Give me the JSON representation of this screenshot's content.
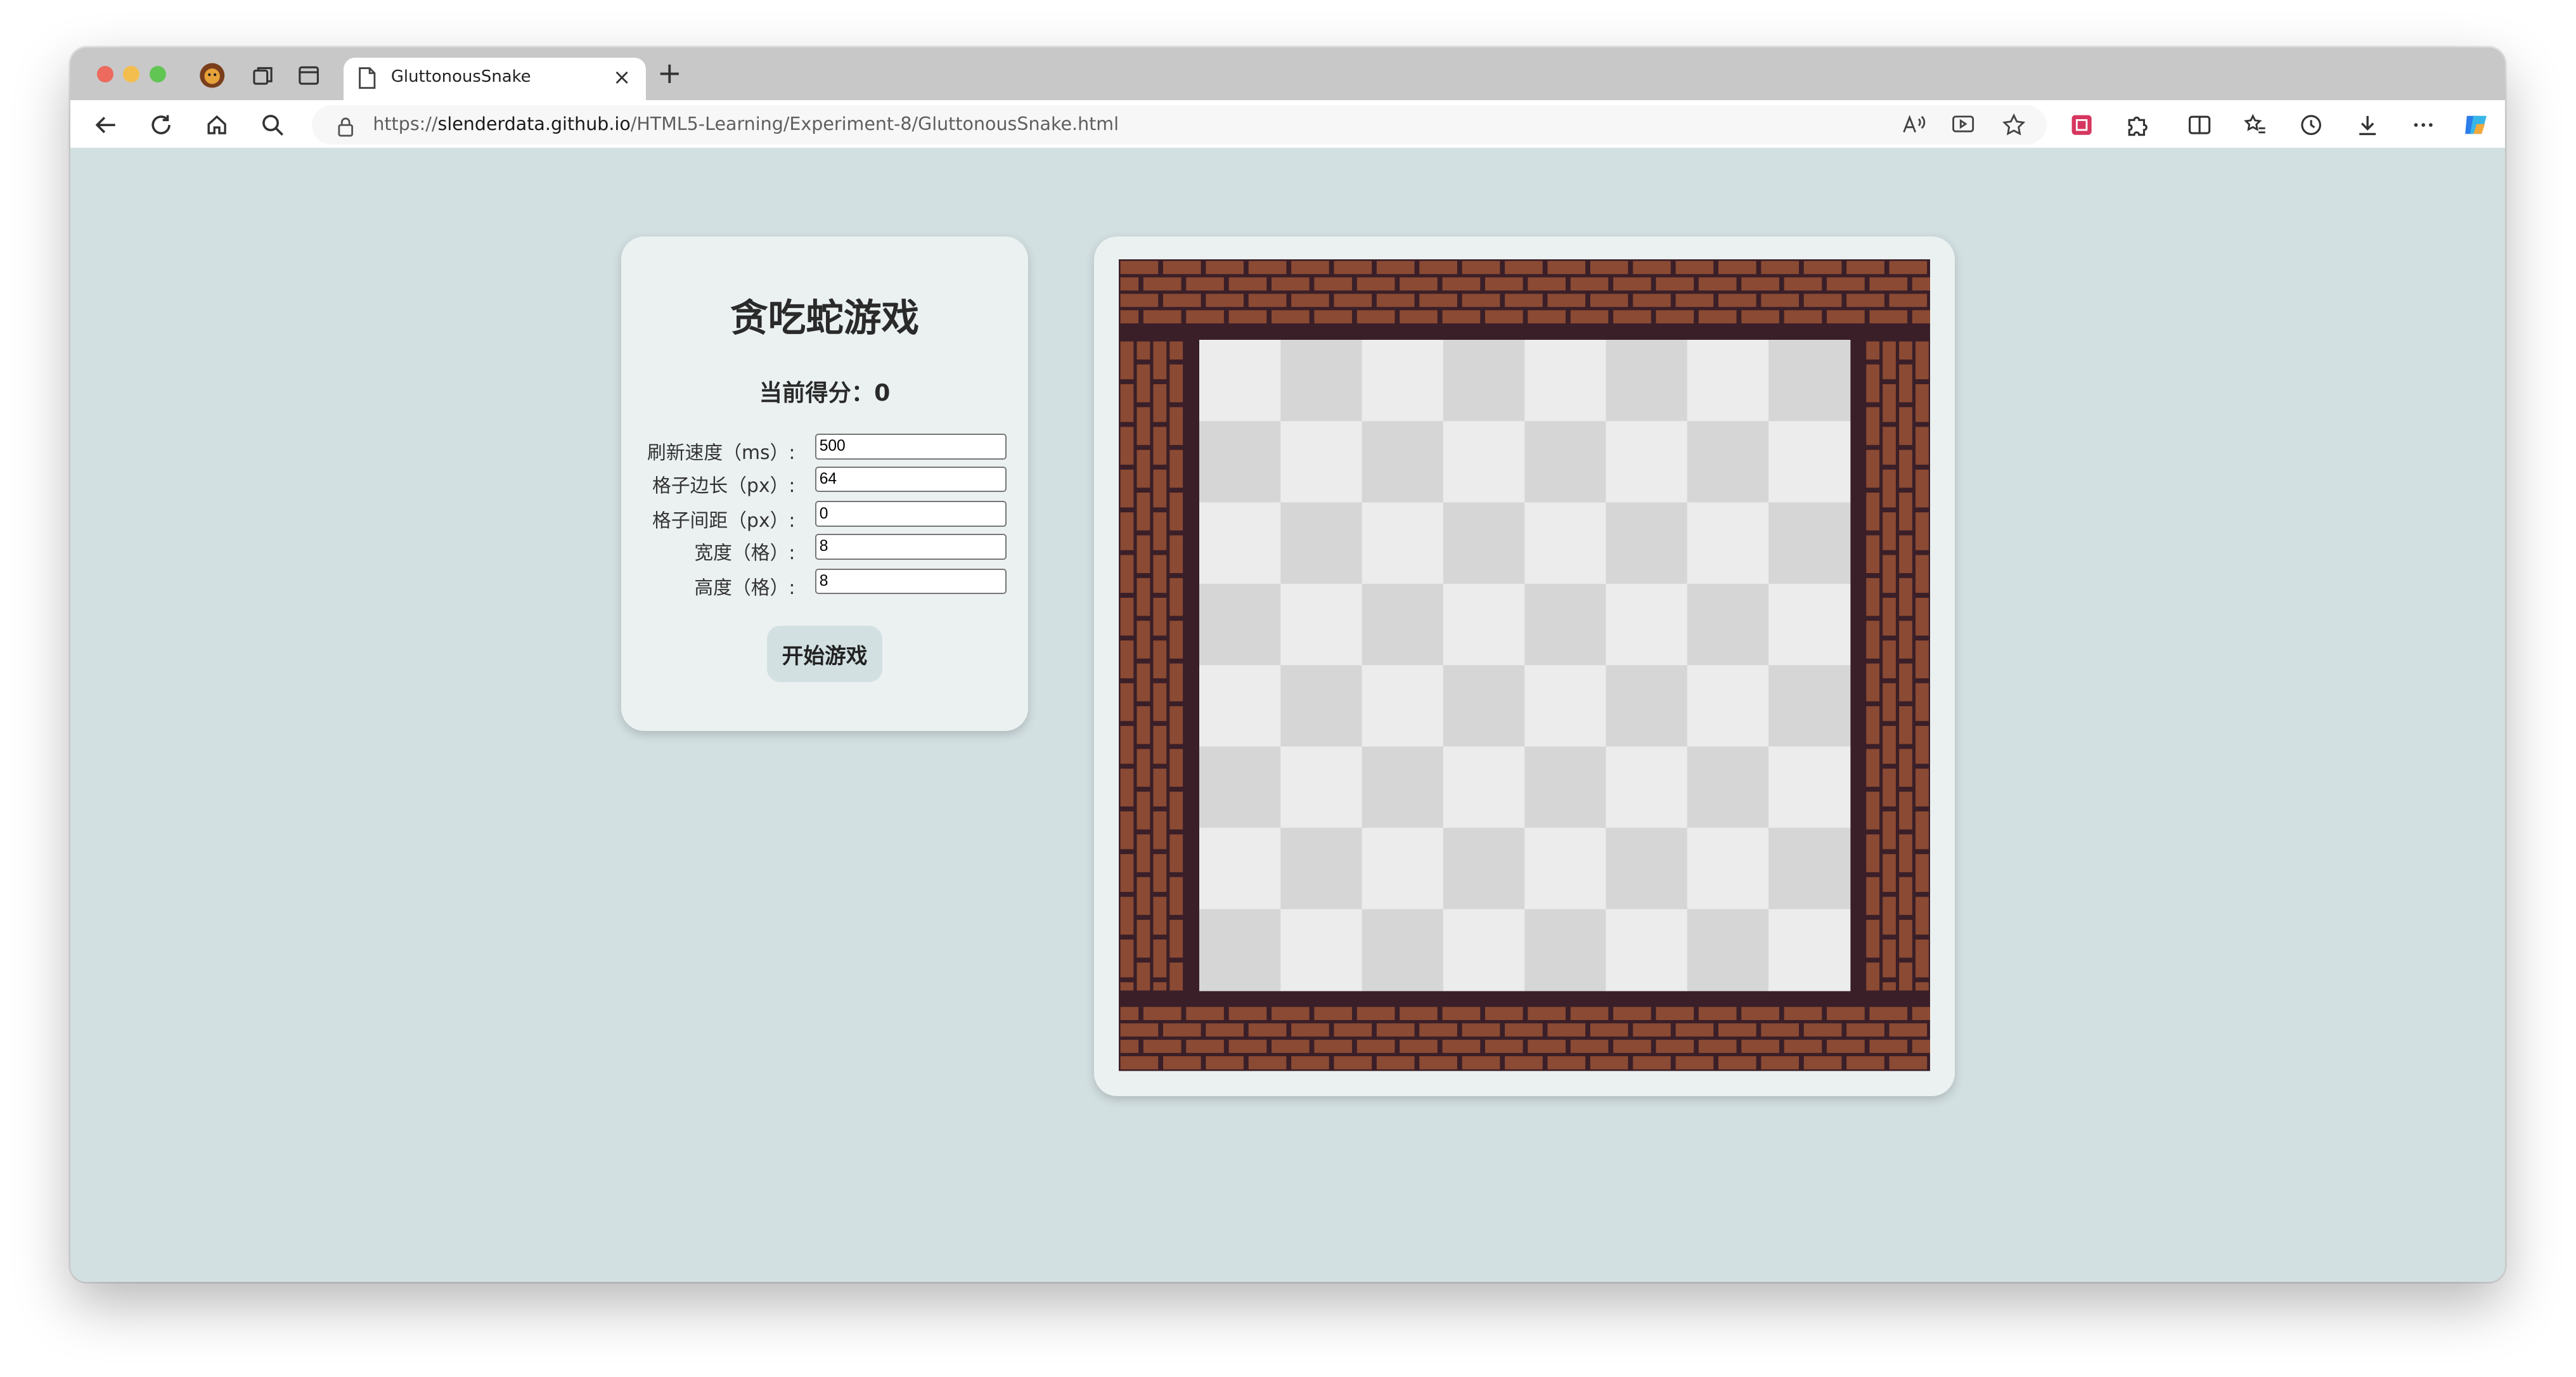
{
  "browser": {
    "tab_title": "GluttonousSnake",
    "tab_close": "×",
    "new_tab": "+",
    "url_prefix": "https://",
    "url_host": "slenderdata.github.io",
    "url_path": "/HTML5-Learning/Experiment-8/GluttonousSnake.html"
  },
  "game": {
    "title": "贪吃蛇游戏",
    "score_label": "当前得分：",
    "score_value": "0",
    "fields": [
      {
        "label": "刷新速度（ms）:",
        "value": "500"
      },
      {
        "label": "格子边长（px）:",
        "value": "64"
      },
      {
        "label": "格子间距（px）:",
        "value": "0"
      },
      {
        "label": "宽度（格）:",
        "value": "8"
      },
      {
        "label": "高度（格）:",
        "value": "8"
      }
    ],
    "start_button": "开始游戏"
  },
  "board": {
    "columns": 8,
    "rows": 8,
    "brick_color": "#8b4a33",
    "mortar_color": "#3a1f28",
    "light_cell": "#ececec",
    "dark_cell": "#d6d6d6"
  },
  "colors": {
    "page_bg": "#d3e0e2",
    "panel_bg": "#ebf1f1"
  }
}
